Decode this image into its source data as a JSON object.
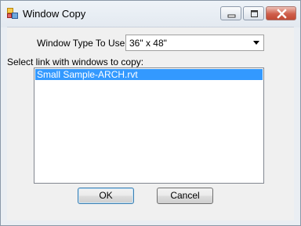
{
  "window": {
    "title": "Window Copy",
    "icons": {
      "app": "app-windows-icon",
      "minimize": "minimize-icon",
      "maximize": "maximize-icon",
      "close": "close-icon"
    }
  },
  "form": {
    "window_type_label": "Window Type To Use:",
    "window_type_value": "36\" x 48\"",
    "select_link_label": "Select link with windows to copy:",
    "links": [
      {
        "label": "Small Sample-ARCH.rvt",
        "selected": true
      }
    ]
  },
  "buttons": {
    "ok_label": "OK",
    "cancel_label": "Cancel"
  },
  "colors": {
    "selection": "#3399ff",
    "close_button": "#c94f3a"
  }
}
